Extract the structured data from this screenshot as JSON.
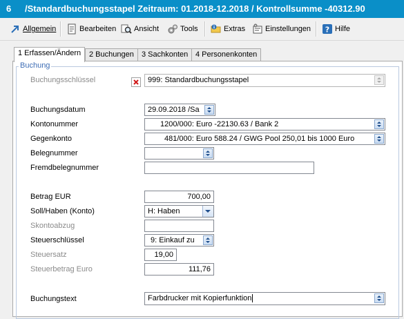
{
  "window": {
    "number": "6",
    "title": "/Standardbuchungsstapel Zeitraum: 01.2018-12.2018 / Kontrollsumme -40312.90"
  },
  "toolbar": {
    "allgemein": "Allgemein",
    "bearbeiten": "Bearbeiten",
    "ansicht": "Ansicht",
    "tools": "Tools",
    "extras": "Extras",
    "einstellungen": "Einstellungen",
    "hilfe": "Hilfe"
  },
  "tabs": [
    {
      "label": "1 Erfassen/Ändern",
      "active": true
    },
    {
      "label": "2 Buchungen",
      "active": false
    },
    {
      "label": "3 Sachkonten",
      "active": false
    },
    {
      "label": "4 Personenkonten",
      "active": false
    }
  ],
  "form": {
    "group_title": "Buchung",
    "buchungsschluessel_label": "Buchungsschlüssel",
    "buchungsschluessel_value": "999: Standardbuchungsstapel",
    "buchungsdatum_label": "Buchungsdatum",
    "buchungsdatum_value": "29.09.2018 /Sa",
    "kontonummer_label": "Kontonummer",
    "kontonummer_value": "1200/000: Euro -22130.63 / Bank 2",
    "gegenkonto_label": "Gegenkonto",
    "gegenkonto_value": "481/000: Euro 588.24 / GWG Pool 250,01 bis 1000 Euro",
    "belegnummer_label": "Belegnummer",
    "belegnummer_value": "",
    "fremdbelegnummer_label": "Fremdbelegnummer",
    "fremdbelegnummer_value": "",
    "betrag_label": "Betrag EUR",
    "betrag_value": "700,00",
    "sollhaben_label": "Soll/Haben (Konto)",
    "sollhaben_value": "H: Haben",
    "skontoabzug_label": "Skontoabzug",
    "skontoabzug_value": "",
    "steuerschluessel_label": "Steuerschlüssel",
    "steuerschluessel_value": "9: Einkauf zu",
    "steuersatz_label": "Steuersatz",
    "steuersatz_value": "19,00",
    "steuerbetrag_label": "Steuerbetrag Euro",
    "steuerbetrag_value": "111,76",
    "buchungstext_label": "Buchungstext",
    "buchungstext_value": "Farbdrucker mit Kopierfunktion"
  },
  "colors": {
    "titlebar": "#0a8fc8",
    "group_title": "#3d6db5"
  }
}
